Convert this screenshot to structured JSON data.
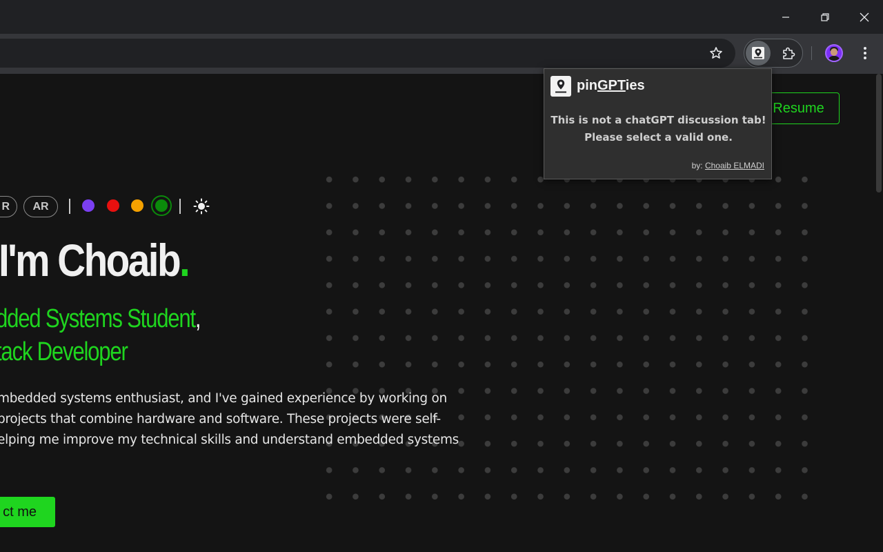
{
  "window": {
    "minimize_glyph": "—",
    "restore_glyph": "⧉",
    "close_glyph": "✕"
  },
  "toolbar": {
    "bookmark_icon": "star-icon",
    "active_extension_icon": "map-pin-icon",
    "extensions_icon": "puzzle-icon",
    "menu_icon": "kebab-menu-icon"
  },
  "page": {
    "resume_label": "Resume",
    "languages": [
      "R",
      "AR"
    ],
    "theme_colors": [
      "#7b3ff2",
      "#e8100f",
      "#f5a100",
      "#0b8a0b"
    ],
    "selected_color": "#0b8a0b",
    "theme_toggle_icon": "sun-icon",
    "hero_title": "I'm Choaib",
    "hero_title_dot": ".",
    "role_line_1": "dded Systems Student",
    "role_line_1_comma": ",",
    "role_line_2": "tack Developer",
    "bio_lines": [
      "mbedded systems enthusiast, and I've gained experience by working on",
      " projects that combine hardware and software. These projects were self-",
      "elping me improve my technical skills and understand embedded systems"
    ],
    "contact_label": "ct me",
    "accent_color": "#1fd51f"
  },
  "popup": {
    "title_prefix": "pin",
    "title_underlined": "GPT",
    "title_suffix": "ies",
    "message_line_1": "This is not a chatGPT discussion tab!",
    "message_line_2": "Please select a valid one.",
    "by_label": "by:",
    "author": "Choaib ELMADI"
  }
}
